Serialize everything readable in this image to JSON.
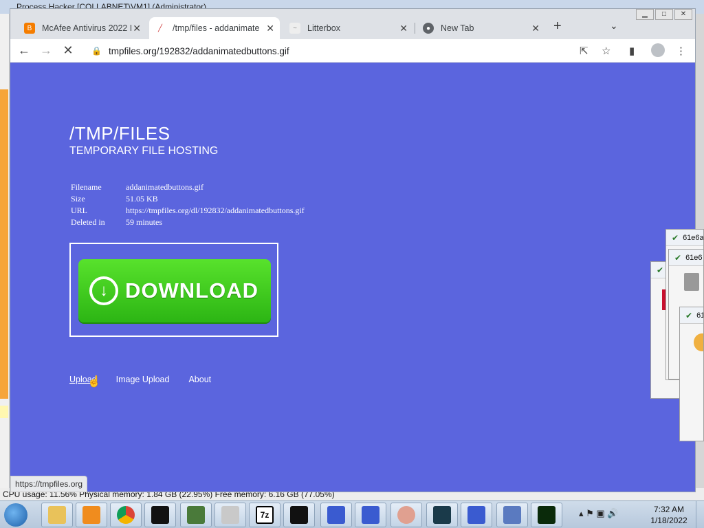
{
  "background": {
    "titlebar": "Process Hacker [COLLABNET\\VM1] (Administrator)",
    "statusbar": "CPU usage: 11.56%   Physical memory: 1.84 GB (22.95%)   Free memory: 6.16 GB (77.05%)"
  },
  "browser": {
    "tabs": [
      {
        "title": "McAfee Antivirus 2022 F",
        "icon": "blogger-icon",
        "color": "#f57d00"
      },
      {
        "title": "/tmp/files - addanimate",
        "icon": "tmpfiles-icon",
        "color": "#ffffff"
      },
      {
        "title": "Litterbox",
        "icon": "litterbox-icon",
        "color": "#dddddd"
      },
      {
        "title": "New Tab",
        "icon": "chrome-icon",
        "color": "#5f6368"
      }
    ],
    "url": "tmpfiles.org/192832/addanimatedbuttons.gif",
    "status_url": "https://tmpfiles.org"
  },
  "page": {
    "title": "/TMP/FILES",
    "subtitle": "TEMPORARY FILE HOSTING",
    "info": [
      {
        "label": "Filename",
        "value": "addanimatedbuttons.gif"
      },
      {
        "label": "Size",
        "value": "51.05 KB"
      },
      {
        "label": "URL",
        "value": "https://tmpfiles.org/dl/192832/addanimatedbuttons.gif"
      },
      {
        "label": "Deleted in",
        "value": "59 minutes"
      }
    ],
    "download_label": "DOWNLOAD",
    "links": {
      "upload": "Upload",
      "image_upload": "Image Upload",
      "about": "About"
    },
    "bg_color": "#5b65de",
    "button_color": "#3ccb1e"
  },
  "side_windows": {
    "w1": "61e6a",
    "w2": "61e6",
    "w3": "61"
  },
  "taskbar": {
    "time": "7:32 AM",
    "date": "1/18/2022",
    "apps": [
      "explorer-icon",
      "media-player-icon",
      "chrome-icon",
      "cmd-icon",
      "process-hacker-icon",
      "installer-icon",
      "7zip-icon",
      "cmd-icon",
      "task-icon",
      "task-icon",
      "chrome-icon",
      "vm-icon",
      "task-icon",
      "network-icon",
      "monitor-icon"
    ]
  }
}
